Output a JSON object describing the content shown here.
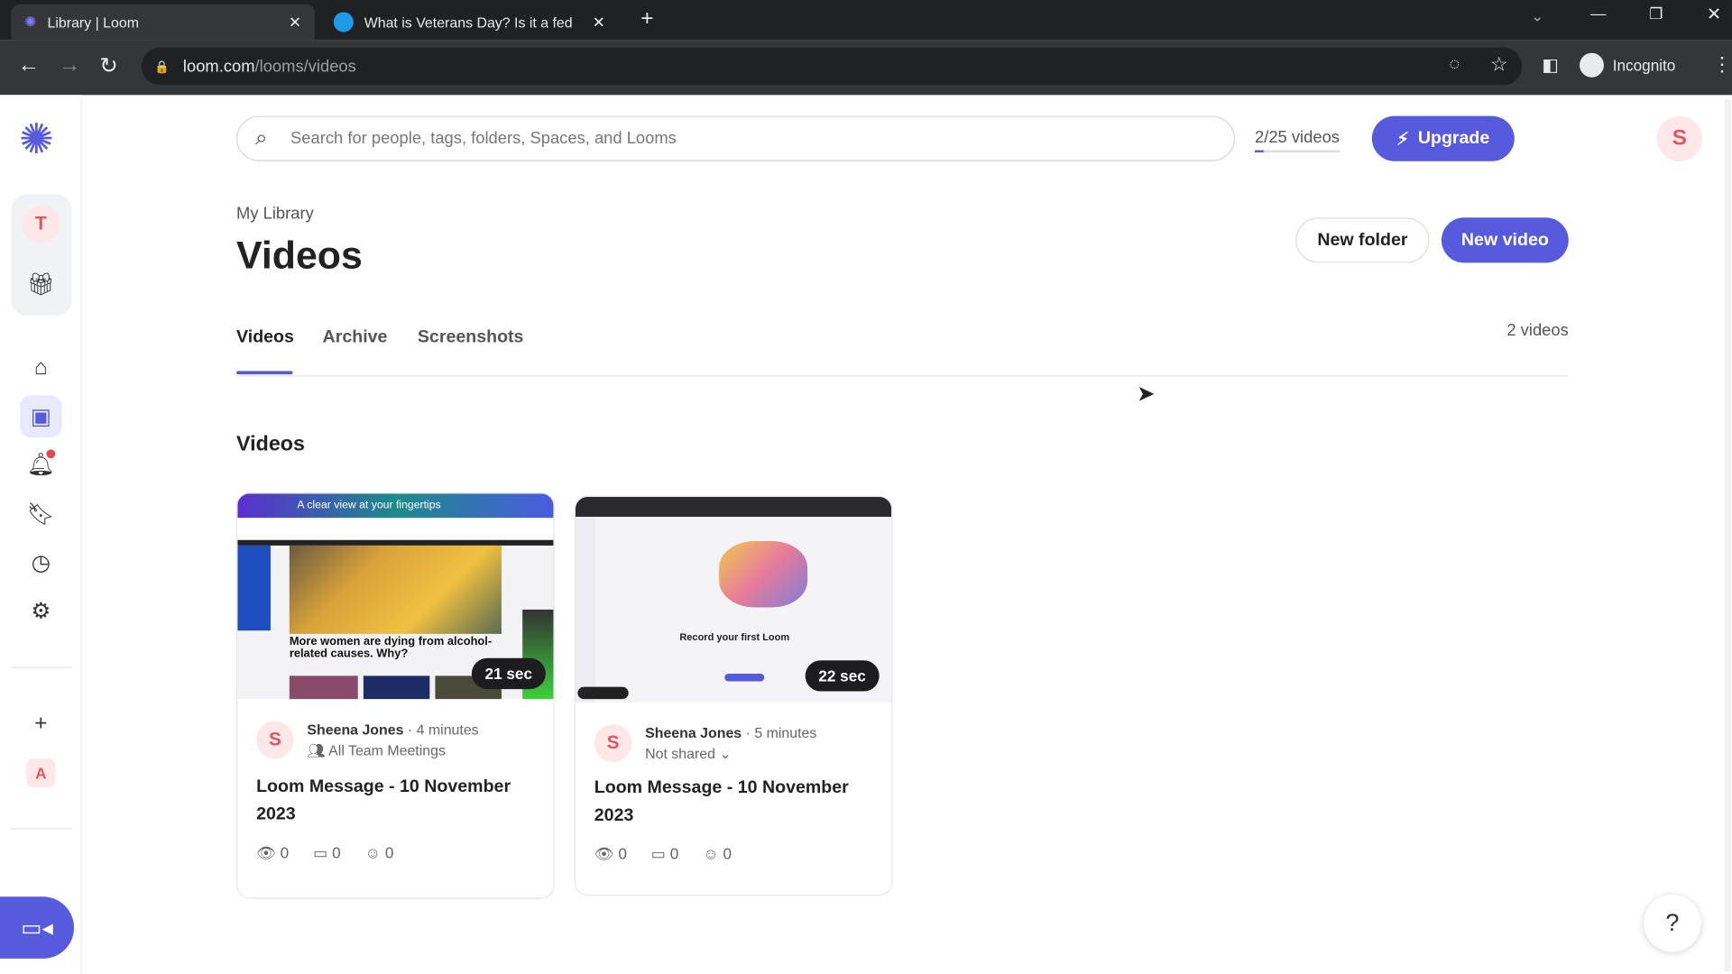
{
  "browser": {
    "tabs": [
      {
        "title": "Library | Loom",
        "active": true
      },
      {
        "title": "What is Veterans Day? Is it a fed",
        "active": false
      }
    ],
    "url_domain": "loom.com",
    "url_path": "/looms/videos",
    "profile": "Incognito"
  },
  "sidebar": {
    "workspace_initial": "T",
    "personal_initial": "A",
    "items": [
      "home-icon",
      "library-icon",
      "bell-icon",
      "bookmark-icon",
      "clock-icon",
      "gear-icon"
    ],
    "add": "+"
  },
  "header": {
    "search_placeholder": "Search for people, tags, folders, Spaces, and Looms",
    "quota": "2/25 videos",
    "upgrade": "Upgrade",
    "avatar": "S"
  },
  "page": {
    "breadcrumb": "My Library",
    "title": "Videos",
    "new_folder": "New folder",
    "new_video": "New video",
    "tabs": [
      "Videos",
      "Archive",
      "Screenshots"
    ],
    "count": "2 videos",
    "section": "Videos"
  },
  "videos": [
    {
      "duration": "21 sec",
      "author": "Sheena Jones",
      "age": "4 minutes",
      "sharing": "All Team Meetings",
      "title": "Loom Message - 10 November 2023",
      "views": "0",
      "comments": "0",
      "reactions": "0",
      "thumb_banner": "A clear view at your fingertips",
      "thumb_headline": "More women are dying from alcohol-related causes. Why?"
    },
    {
      "duration": "22 sec",
      "author": "Sheena Jones",
      "age": "5 minutes",
      "sharing": "Not shared",
      "title": "Loom Message - 10 November 2023",
      "views": "0",
      "comments": "0",
      "reactions": "0",
      "thumb_caption": "Record your first Loom"
    }
  ],
  "help": "?",
  "colors": {
    "accent": "#565add"
  }
}
